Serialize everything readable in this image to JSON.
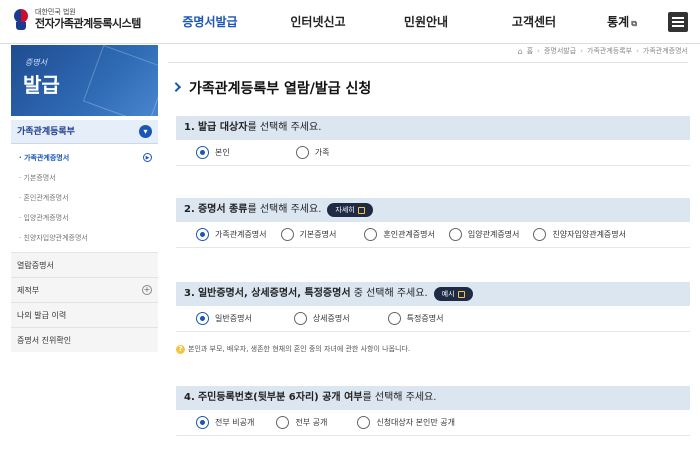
{
  "header": {
    "org_sub": "대한민국 법원",
    "org_main": "전자가족관계등록시스템",
    "nav": [
      {
        "label": "증명서발급",
        "active": true
      },
      {
        "label": "인터넷신고",
        "active": false
      },
      {
        "label": "민원안내",
        "active": false
      },
      {
        "label": "고객센터",
        "active": false
      },
      {
        "label": "통계",
        "active": false,
        "external_icon": "external-link-icon"
      }
    ],
    "menu_icon": "hamburger-icon"
  },
  "side_banner": {
    "small_text": "증명서",
    "big_text": "발급"
  },
  "sidebar": {
    "head": {
      "label": "가족관계등록부",
      "toggle_icon": "chevron-down-icon"
    },
    "sub_items": [
      {
        "label": "· 가족관계증명서",
        "active": true
      },
      {
        "label": "· 기본증명서",
        "active": false
      },
      {
        "label": "· 혼인관계증명서",
        "active": false
      },
      {
        "label": "· 입양관계증명서",
        "active": false
      },
      {
        "label": "· 친양자입양관계증명서",
        "active": false
      }
    ],
    "items": [
      {
        "label": "열람증명서"
      },
      {
        "label": "제적부",
        "expandable": true
      },
      {
        "label": "나의 발급 이력"
      },
      {
        "label": "증명서 진위확인"
      }
    ]
  },
  "breadcrumb": {
    "home_icon": "home-icon",
    "items": [
      "홈",
      "증명서발급",
      "가족관계등록부",
      "가족관계증명서"
    ]
  },
  "page_title": "가족관계등록부 열람/발급 신청",
  "sections": [
    {
      "number": "1.",
      "strong": "발급 대상자",
      "rest": "를 선택해 주세요.",
      "options": [
        {
          "label": "본인",
          "selected": true
        },
        {
          "label": "가족",
          "selected": false
        }
      ]
    },
    {
      "number": "2.",
      "strong": "증명서 종류",
      "rest": "를 선택해 주세요.",
      "button": "자세히",
      "options": [
        {
          "label": "가족관계증명서",
          "selected": true
        },
        {
          "label": "기본증명서",
          "selected": false
        },
        {
          "label": "혼인관계증명서",
          "selected": false
        },
        {
          "label": "입양관계증명서",
          "selected": false
        },
        {
          "label": "친양자입양관계증명서",
          "selected": false
        }
      ]
    },
    {
      "number": "3.",
      "strong": "일반증명서, 상세증명서, 특정증명서",
      "rest": " 중 선택해 주세요.",
      "button": "예시",
      "options": [
        {
          "label": "일반증명서",
          "selected": true
        },
        {
          "label": "상세증명서",
          "selected": false
        },
        {
          "label": "특정증명서",
          "selected": false
        }
      ]
    },
    {
      "number": "4.",
      "strong": "주민등록번호(뒷부분 6자리) 공개 여부",
      "rest": "를 선택해 주세요.",
      "options": [
        {
          "label": "전부 비공개",
          "selected": true
        },
        {
          "label": "전부 공개",
          "selected": false
        },
        {
          "label": "신청대상자 본인만 공개",
          "selected": false
        }
      ]
    }
  ],
  "notice": "본인과 부모, 배우자, 생존한 현재의 혼인 중의 자녀에 관한 사항이 나옵니다.",
  "colors": {
    "accent": "#1a56b8",
    "section_bg": "#dce6f1",
    "pill_bg": "#1f2a44"
  }
}
